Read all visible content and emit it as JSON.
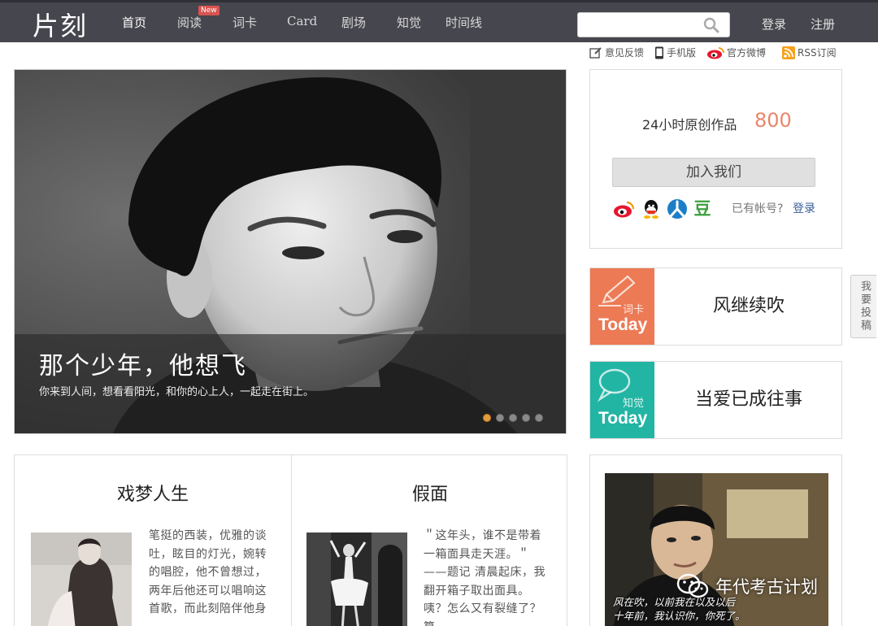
{
  "nav": {
    "logo": "片刻",
    "items": [
      {
        "label": "首页",
        "active": true
      },
      {
        "label": "阅读"
      },
      {
        "label": "词卡"
      },
      {
        "label": "Card"
      },
      {
        "label": "剧场"
      },
      {
        "label": "知觉"
      },
      {
        "label": "时间线"
      }
    ],
    "new_badge": "New",
    "search_placeholder": "",
    "login": "登录",
    "register": "注册"
  },
  "toplinks": {
    "feedback": "意见反馈",
    "mobile": "手机版",
    "weibo": "官方微博",
    "rss": "RSS订阅"
  },
  "hero": {
    "title": "那个少年，他想飞",
    "subtitle": "你来到人间，想看看阳光，和你的心上人，一起走在街上。",
    "active_dot": 0,
    "dot_count": 5
  },
  "join": {
    "label": "24小时原创作品",
    "count": "800",
    "button": "加入我们",
    "has_account": "已有帐号?",
    "login": "登录",
    "social_icons": [
      "weibo-icon",
      "qq-icon",
      "renren-icon",
      "douban-icon"
    ],
    "douban_glyph": "豆"
  },
  "today": [
    {
      "tag": "词卡",
      "label": "Today",
      "title": "风继续吹",
      "color": "#ec7a55"
    },
    {
      "tag": "知觉",
      "label": "Today",
      "title": "当爱已成往事",
      "color": "#22b5a4"
    }
  ],
  "articles": [
    {
      "title": "戏梦人生",
      "text": "笔挺的西装，优雅的谈吐，眩目的灯光，婉转的唱腔，他不曾想过，两年后他还可以唱响这首歌，而此刻陪伴他身"
    },
    {
      "title": "假面",
      "text": "＂这年头，谁不是带着一箱面具走天涯。＂——题记 清晨起床，我翻开箱子取出面具。咦？怎么又有裂缝了？算"
    }
  ],
  "side_photo": {
    "caption_line1": "风在吹，以前我在以及以后",
    "caption_line2": "十年前，我认识你，你死了。"
  },
  "watermark": "年代考古计划",
  "contribute": "我要投稿"
}
